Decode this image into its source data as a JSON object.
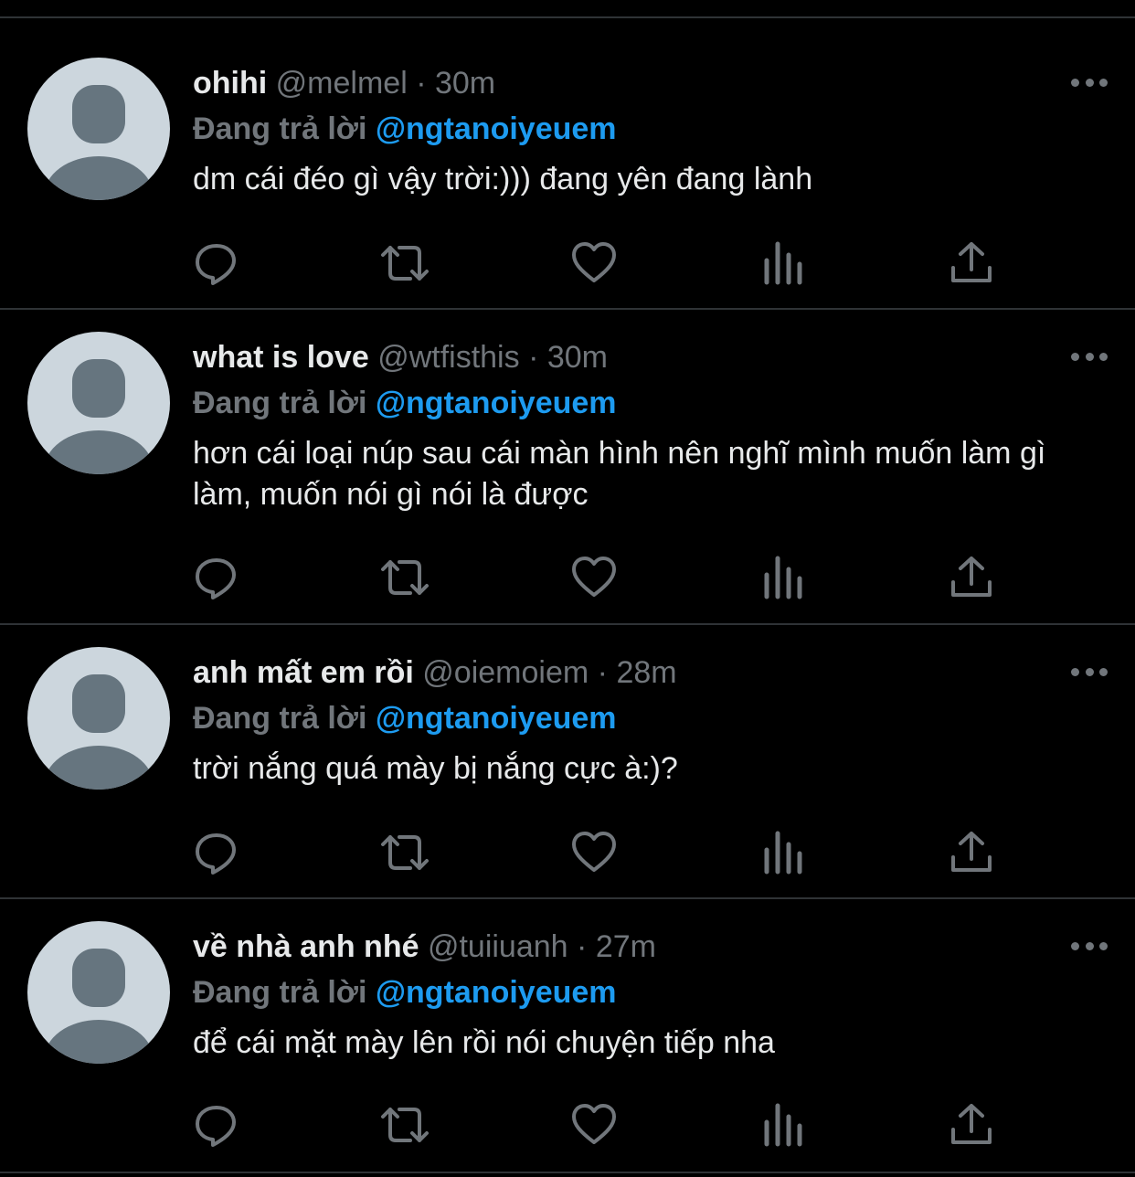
{
  "colors": {
    "background": "#000000",
    "text": "#e7e9ea",
    "secondary": "#71767b",
    "accent": "#1d9bf0",
    "divider": "#2f3336",
    "avatar_bg": "#ccd6dd",
    "avatar_figure": "#66757f"
  },
  "reply_prefix": "Đang trả lời",
  "tweets": [
    {
      "display_name": "ohihi",
      "handle": "@melmel",
      "separator": "·",
      "time": "30m",
      "reply_to": "@ngtanoiyeuem",
      "text": "dm cái đéo gì vậy trời:))) đang yên đang lành",
      "icons": [
        "reply-icon",
        "retweet-icon",
        "like-icon",
        "analytics-icon",
        "share-icon"
      ]
    },
    {
      "display_name": "what is love",
      "handle": "@wtfisthis",
      "separator": "·",
      "time": "30m",
      "reply_to": "@ngtanoiyeuem",
      "text": "hơn cái loại núp sau cái màn hình nên nghĩ mình muốn làm gì làm, muốn nói gì nói là được",
      "icons": [
        "reply-icon",
        "retweet-icon",
        "like-icon",
        "analytics-icon",
        "share-icon"
      ]
    },
    {
      "display_name": "anh mất em rồi",
      "handle": "@oiemoiem",
      "separator": "·",
      "time": "28m",
      "reply_to": "@ngtanoiyeuem",
      "text": "trời nắng quá mày bị nắng cực à:)?",
      "icons": [
        "reply-icon",
        "retweet-icon",
        "like-icon",
        "analytics-icon",
        "share-icon"
      ]
    },
    {
      "display_name": "về nhà anh nhé",
      "handle": "@tuiiuanh",
      "separator": "·",
      "time": "27m",
      "reply_to": "@ngtanoiyeuem",
      "text": "để cái mặt mày lên rồi nói chuyện tiếp nha",
      "icons": [
        "reply-icon",
        "retweet-icon",
        "like-icon",
        "analytics-icon",
        "share-icon"
      ]
    }
  ]
}
